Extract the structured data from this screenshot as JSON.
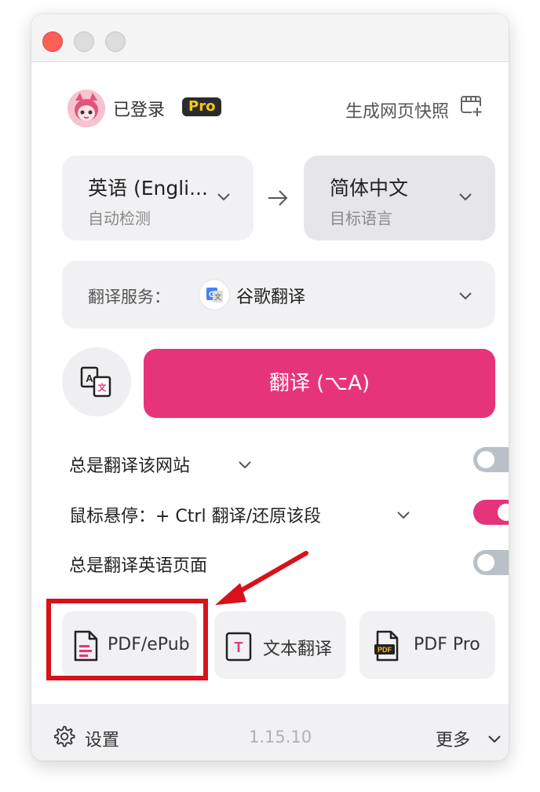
{
  "header": {
    "login_status": "已登录",
    "pro_badge": "Pro",
    "snapshot_label": "生成网页快照"
  },
  "language": {
    "source": {
      "name": "英语 (Engli...",
      "sub": "自动检测"
    },
    "target": {
      "name": "简体中文",
      "sub": "目标语言"
    }
  },
  "service": {
    "label": "翻译服务：",
    "name": "谷歌翻译"
  },
  "translate_button": "翻译 (⌥A)",
  "options": [
    {
      "label": "总是翻译该网站",
      "enabled": false
    },
    {
      "label": "鼠标悬停：+ Ctrl 翻译/还原该段",
      "enabled": true
    },
    {
      "label": "总是翻译英语页面",
      "enabled": false
    }
  ],
  "tools": [
    {
      "label": "PDF/ePub"
    },
    {
      "label": "文本翻译"
    },
    {
      "label": "PDF Pro"
    }
  ],
  "footer": {
    "settings": "设置",
    "version": "1.15.10",
    "more": "更多"
  },
  "colors": {
    "accent": "#e6347a",
    "annotation": "#d8111b"
  }
}
